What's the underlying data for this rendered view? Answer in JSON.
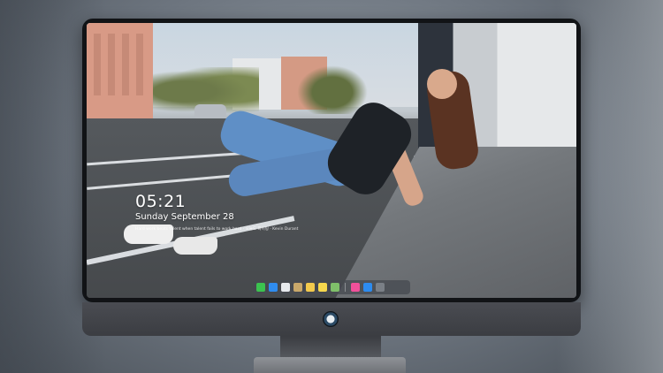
{
  "lockscreen": {
    "time": "05:21",
    "date": "Sunday September 28",
    "quote": "Hard work beats talent when talent fails to work hard · 오늘도 화이팅 · Kevin Durant"
  },
  "dock": {
    "apps": [
      {
        "name": "messages-icon",
        "color": "#3bc24f"
      },
      {
        "name": "finder-icon",
        "color": "#2f8cf0"
      },
      {
        "name": "safari-icon",
        "color": "#e7eaee"
      },
      {
        "name": "preview-icon",
        "color": "#c9a86a"
      },
      {
        "name": "clapper-icon",
        "color": "#f2c94c"
      },
      {
        "name": "notes-icon",
        "color": "#f7d84d"
      },
      {
        "name": "photos-icon",
        "color": "#7fbf6a"
      },
      {
        "name": "music-icon",
        "color": "#f0509a"
      },
      {
        "name": "app-store-icon",
        "color": "#2d8cf0"
      },
      {
        "name": "camera-icon",
        "color": "#7a7f86"
      }
    ]
  }
}
